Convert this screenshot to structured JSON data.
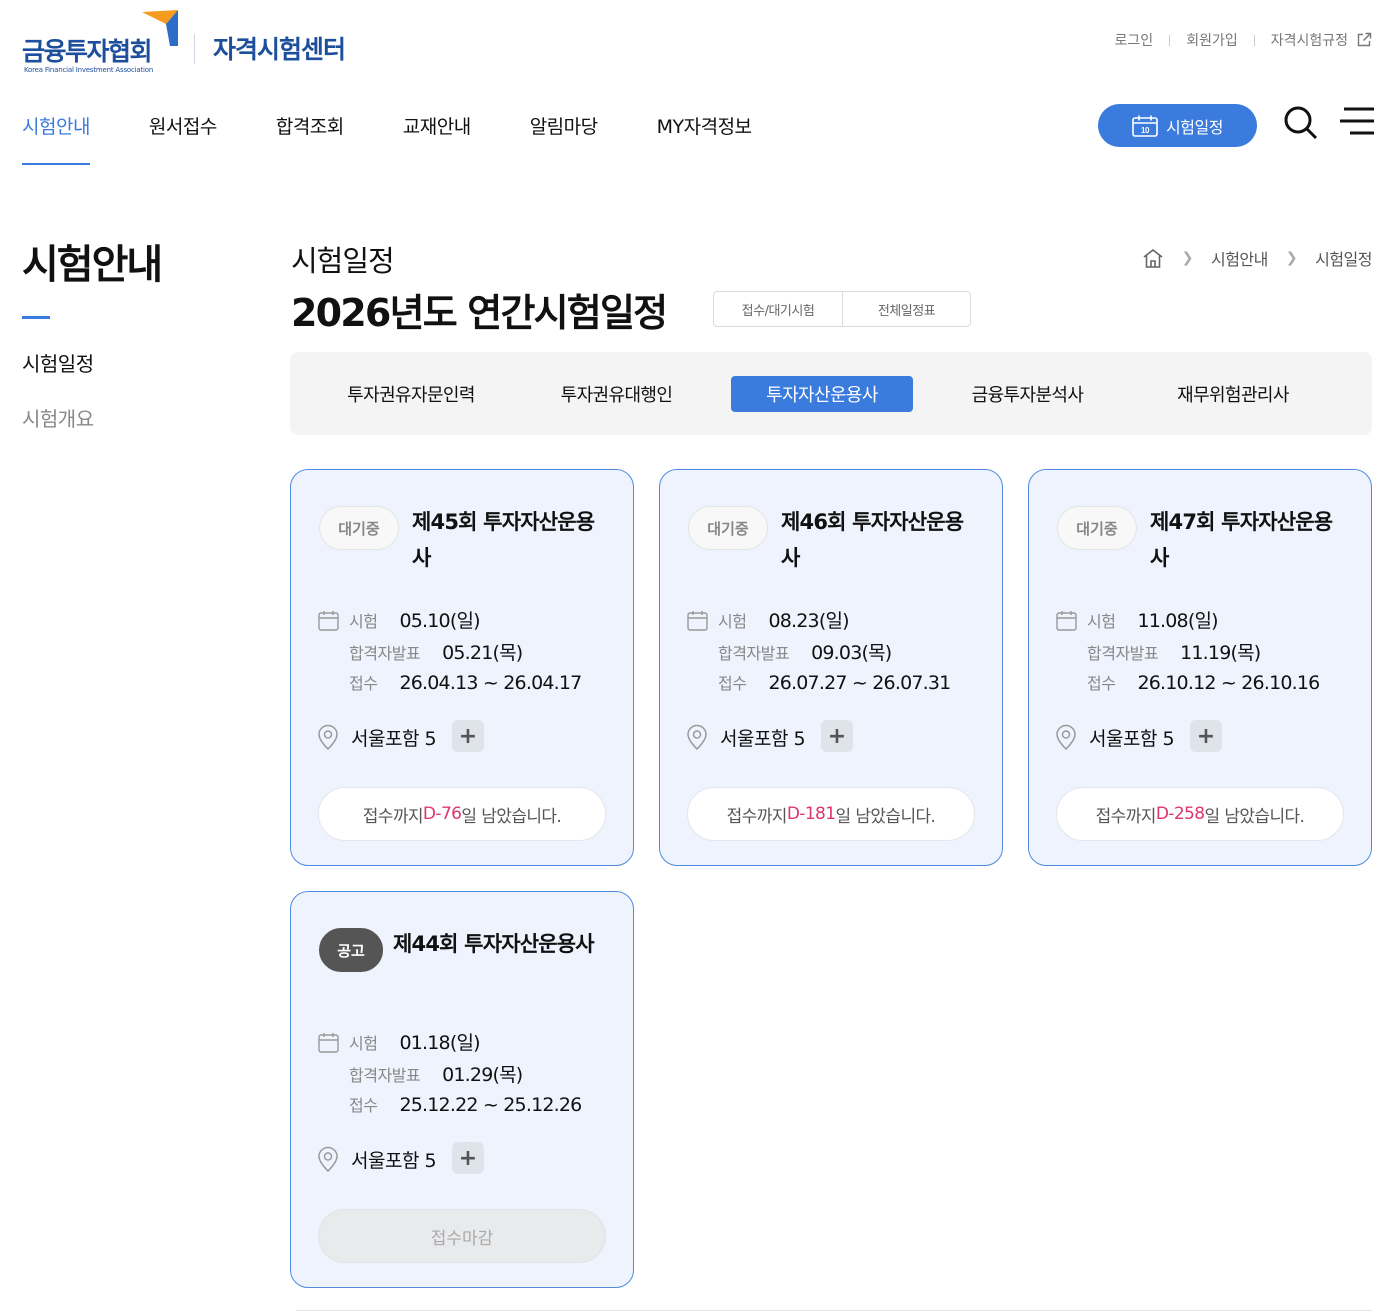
{
  "header": {
    "logo_text": "금융투자협회",
    "logo_sub": "Korea Financial Investment Association",
    "site_title": "자격시험센터",
    "util": {
      "login": "로그인",
      "join": "회원가입",
      "rules": "자격시험규정"
    },
    "gnb": [
      "시험안내",
      "원서접수",
      "합격조회",
      "교재안내",
      "알림마당",
      "MY자격정보"
    ],
    "schedule_button": "시험일정",
    "calendar_icon_num": "10"
  },
  "sidebar": {
    "title": "시험안내",
    "items": [
      "시험일정",
      "시험개요"
    ]
  },
  "main": {
    "sub_title": "시험일정",
    "title": "2026년도 연간시험일정",
    "view_buttons": [
      "접수/대기시험",
      "전체일정표"
    ],
    "breadcrumb": [
      "시험안내",
      "시험일정"
    ],
    "tabs": [
      "투자권유자문인력",
      "투자권유대행인",
      "투자자산운용사",
      "금융투자분석사",
      "재무위험관리사"
    ],
    "active_tab": "투자자산운용사"
  },
  "labels": {
    "exam": "시험",
    "announce": "합격자발표",
    "apply": "접수",
    "dday_prefix": "접수까지",
    "dday_suffix": "일 남았습니다."
  },
  "cards": [
    {
      "badge": "대기중",
      "title": "제45회 투자자산운용사",
      "exam": "05.10(일)",
      "announce": "05.21(목)",
      "apply": "26.04.13 ~ 26.04.17",
      "location": "서울포함 5",
      "dday": "D-76",
      "plus": "+"
    },
    {
      "badge": "대기중",
      "title": "제46회 투자자산운용사",
      "exam": "08.23(일)",
      "announce": "09.03(목)",
      "apply": "26.07.27 ~ 26.07.31",
      "location": "서울포함 5",
      "dday": "D-181",
      "plus": "+"
    },
    {
      "badge": "대기중",
      "title": "제47회 투자자산운용사",
      "exam": "11.08(일)",
      "announce": "11.19(목)",
      "apply": "26.10.12 ~ 26.10.16",
      "location": "서울포함 5",
      "dday": "D-258",
      "plus": "+"
    },
    {
      "badge": "공고",
      "title": "제44회 투자자산운용사",
      "exam": "01.18(일)",
      "announce": "01.29(목)",
      "apply": "25.12.22 ~ 25.12.26",
      "location": "서울포함 5",
      "closed": "접수마감",
      "plus": "+"
    }
  ],
  "colors": {
    "accent": "#3a7bdd",
    "brand": "#1d4f9c",
    "dday": "#e0356c",
    "card_bg": "#eef3fd",
    "card_border": "#4f8be0"
  }
}
